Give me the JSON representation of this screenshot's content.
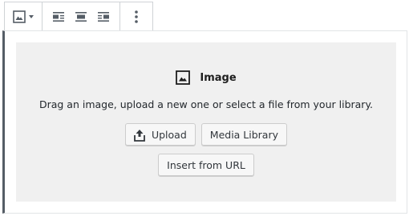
{
  "toolbar": {
    "image_icon": "image-icon",
    "align_left_icon": "align-left-icon",
    "align_center_icon": "align-center-icon",
    "align_right_icon": "align-right-icon",
    "more_icon": "more-vertical-icon"
  },
  "placeholder": {
    "title": "Image",
    "instructions": "Drag an image, upload a new one or select a file from your library.",
    "upload_label": "Upload",
    "media_library_label": "Media Library",
    "insert_url_label": "Insert from URL"
  },
  "colors": {
    "icon": "#555d66",
    "placeholder_bg": "#f0f0f0",
    "block_border_accent": "#555d66"
  }
}
